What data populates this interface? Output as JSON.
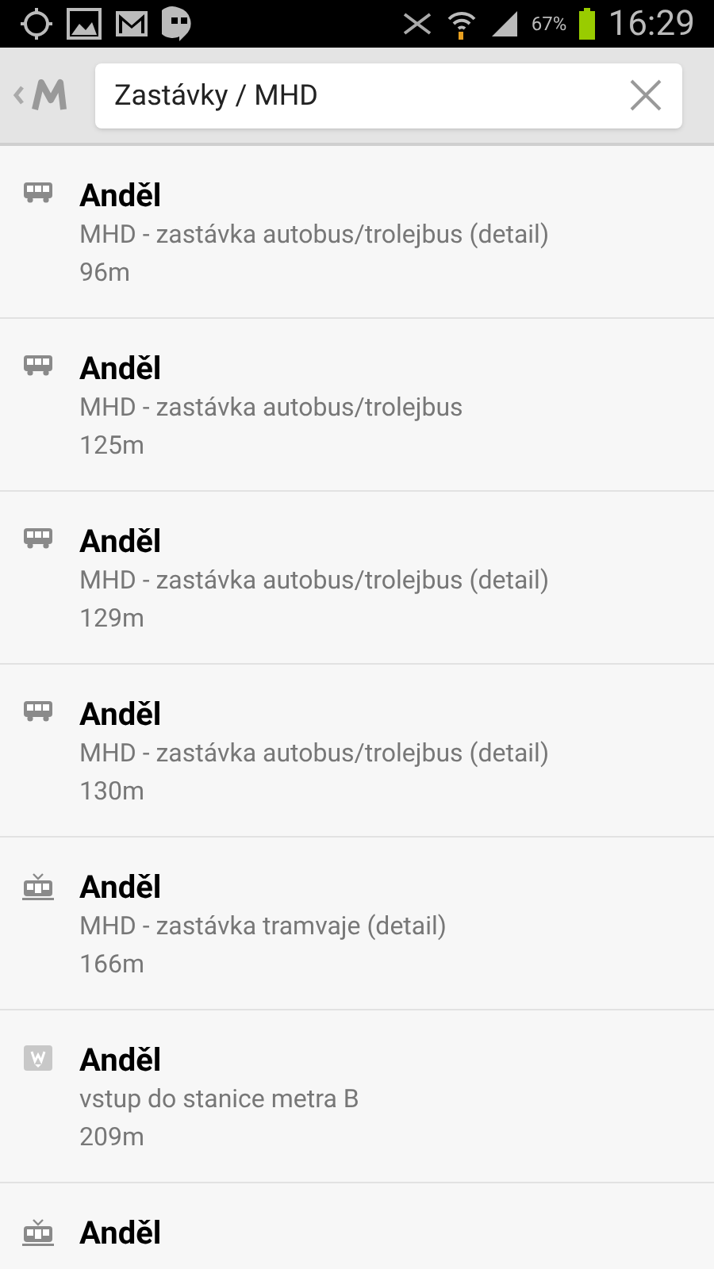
{
  "status_bar": {
    "battery": "67%",
    "time": "16:29"
  },
  "search": {
    "value": "Zastávky / MHD"
  },
  "results": [
    {
      "kind": "bus",
      "title": "Anděl",
      "subtitle": "MHD - zastávka autobus/trolejbus (detail)",
      "distance": "96m"
    },
    {
      "kind": "bus",
      "title": "Anděl",
      "subtitle": "MHD - zastávka autobus/trolejbus",
      "distance": "125m"
    },
    {
      "kind": "bus",
      "title": "Anděl",
      "subtitle": "MHD - zastávka autobus/trolejbus (detail)",
      "distance": "129m"
    },
    {
      "kind": "bus",
      "title": "Anděl",
      "subtitle": "MHD - zastávka autobus/trolejbus (detail)",
      "distance": "130m"
    },
    {
      "kind": "tram",
      "title": "Anděl",
      "subtitle": "MHD - zastávka tramvaje (detail)",
      "distance": "166m"
    },
    {
      "kind": "metro",
      "title": "Anděl",
      "subtitle": "vstup do stanice metra B",
      "distance": "209m"
    },
    {
      "kind": "tram",
      "title": "Anděl"
    }
  ]
}
